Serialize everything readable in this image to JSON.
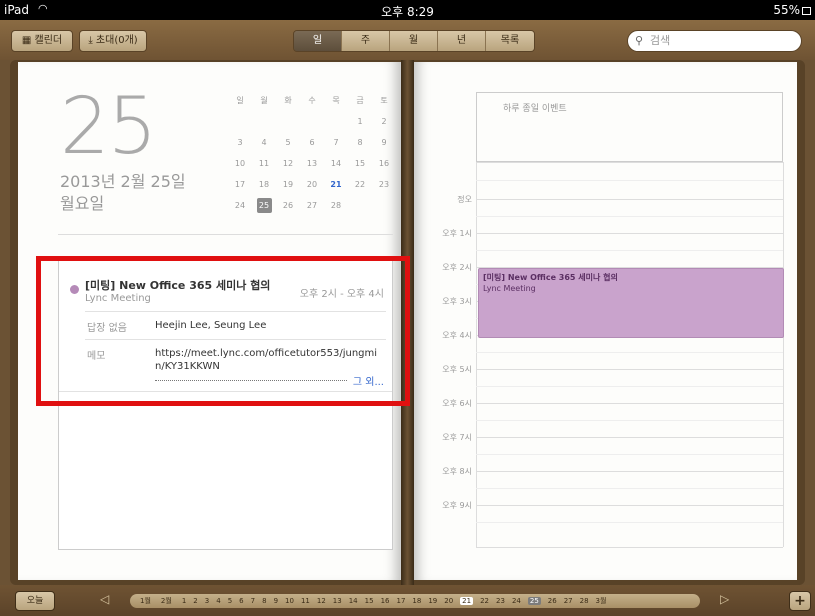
{
  "status": {
    "device": "iPad",
    "time": "오후 8:29",
    "battery": "55%"
  },
  "toolbar": {
    "calendars_label": "캘린더",
    "invites_label": "초대(0개)",
    "view_tabs": [
      "일",
      "주",
      "월",
      "년",
      "목록"
    ],
    "active_tab": "일",
    "search_placeholder": "검색"
  },
  "left_page": {
    "big_day": "25",
    "full_date": "2013년 2월 25일",
    "weekday": "월요일",
    "mini_calendar": {
      "weekday_headers": [
        "일",
        "월",
        "화",
        "수",
        "목",
        "금",
        "토"
      ],
      "weeks": [
        [
          "",
          "",
          "",
          "",
          "",
          "1",
          "2"
        ],
        [
          "3",
          "4",
          "5",
          "6",
          "7",
          "8",
          "9"
        ],
        [
          "10",
          "11",
          "12",
          "13",
          "14",
          "15",
          "16"
        ],
        [
          "17",
          "18",
          "19",
          "20",
          "21",
          "22",
          "23"
        ],
        [
          "24",
          "25",
          "26",
          "27",
          "28",
          "",
          ""
        ]
      ],
      "selected_day": "25",
      "current_day": "21"
    },
    "event": {
      "title": "[미팅] New Office 365 세미나 협의",
      "subtitle": "Lync Meeting",
      "time": "오후 2시 - 오후 4시",
      "status_label": "답장 없음",
      "attendees": "Heejin Lee, Seung Lee",
      "memo_label": "메모",
      "memo": "https://meet.lync.com/officetutor553/jungmin/KY31KKWN",
      "more_link": "그 외..."
    }
  },
  "right_page": {
    "all_day_label": "하루 종일 이벤트",
    "hours": [
      "정오",
      "오후 1시",
      "오후 2시",
      "오후 3시",
      "오후 4시",
      "오후 5시",
      "오후 6시",
      "오후 7시",
      "오후 8시",
      "오후 9시"
    ],
    "event_block": {
      "title": "[미팅] New Office 365 세미나 협의",
      "subtitle": "Lync Meeting"
    }
  },
  "bottom": {
    "today_label": "오늘",
    "day_rail": [
      "1월",
      "2월",
      "1",
      "2",
      "3",
      "4",
      "5",
      "6",
      "7",
      "8",
      "9",
      "10",
      "11",
      "12",
      "13",
      "14",
      "15",
      "16",
      "17",
      "18",
      "19",
      "20",
      "21",
      "22",
      "23",
      "24",
      "25",
      "26",
      "27",
      "28",
      "3월"
    ],
    "add_label": "+"
  }
}
